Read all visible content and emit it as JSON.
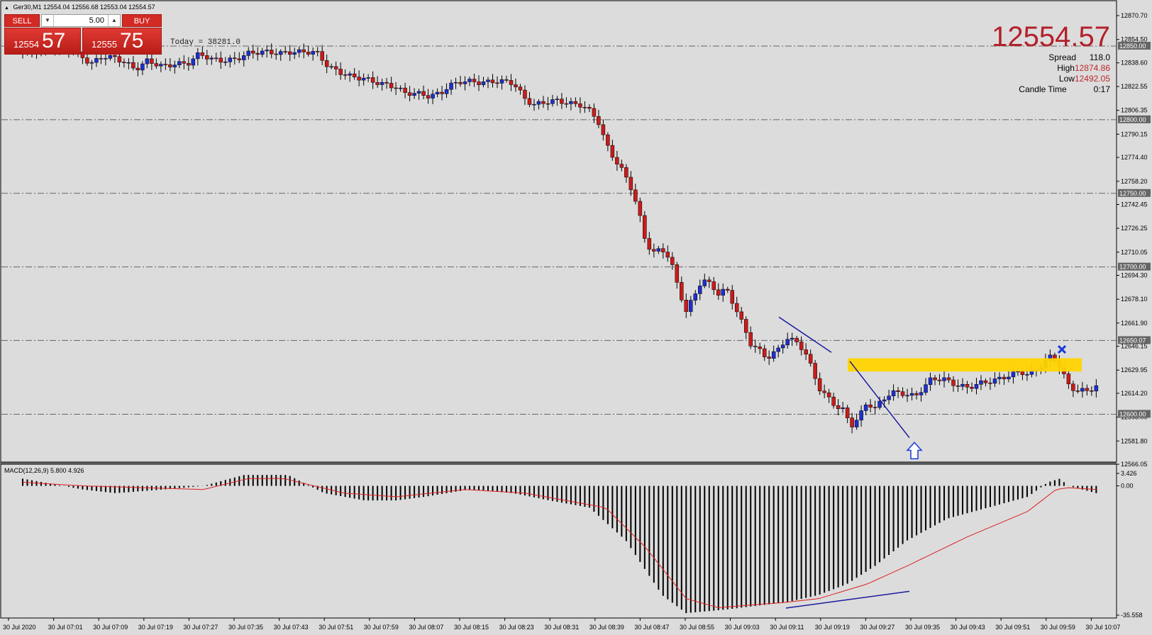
{
  "header": {
    "symbol_line": "Ger30,M1  12554.04 12556.68 12553.04 12554.57"
  },
  "trade_panel": {
    "sell_label": "SELL",
    "buy_label": "BUY",
    "lot_value": "5.00",
    "sell_small": "12554",
    "sell_big": "57",
    "buy_small": "12555",
    "buy_big": "75"
  },
  "info_panel": {
    "price": "12554.57",
    "spread_label": "Spread",
    "spread_value": "118.0",
    "high_label": "High",
    "high_value": "12874.86",
    "low_label": "Low",
    "low_value": "12492.05",
    "candle_time_label": "Candle Time",
    "candle_time_value": "0:17"
  },
  "today_label": "Today = 38281.0",
  "macd_label": "MACD(12,26,9) 5.800 4.926",
  "colors": {
    "background": "#dcdcdc",
    "bull": "#1f2fd0",
    "bear": "#cc1b1b",
    "highlight_zone": "#ffd400",
    "signal_line": "#e02020",
    "trendline": "#1a1aa0",
    "accent_price": "#b3212a"
  },
  "chart_data": {
    "type": "candlestick",
    "symbol": "Ger30",
    "timeframe": "M1",
    "y_axis_ticks": [
      "12870.70",
      "12854.50",
      "12838.60",
      "12822.55",
      "12806.35",
      "12790.15",
      "12774.40",
      "12758.20",
      "12742.45",
      "12726.25",
      "12710.05",
      "12694.30",
      "12678.10",
      "12661.90",
      "12646.15",
      "12629.95",
      "12614.20",
      "12598.00",
      "12581.80",
      "12566.05"
    ],
    "price_levels": [
      "12850.00",
      "12800.00",
      "12750.00",
      "12700.00",
      "12650.07",
      "12600.00"
    ],
    "ylim": [
      12566.05,
      12870.7
    ],
    "x_axis_ticks": [
      "30 Jul 2020",
      "30 Jul 07:01",
      "30 Jul 07:09",
      "30 Jul 07:19",
      "30 Jul 07:27",
      "30 Jul 07:35",
      "30 Jul 07:43",
      "30 Jul 07:51",
      "30 Jul 07:59",
      "30 Jul 08:07",
      "30 Jul 08:15",
      "30 Jul 08:23",
      "30 Jul 08:31",
      "30 Jul 08:39",
      "30 Jul 08:47",
      "30 Jul 08:55",
      "30 Jul 09:03",
      "30 Jul 09:11",
      "30 Jul 09:19",
      "30 Jul 09:27",
      "30 Jul 09:35",
      "30 Jul 09:43",
      "30 Jul 09:51",
      "30 Jul 09:59",
      "30 Jul 10:07"
    ],
    "close_path": [
      [
        0,
        12846
      ],
      [
        8,
        12847
      ],
      [
        16,
        12849
      ],
      [
        24,
        12848
      ],
      [
        30,
        12842
      ],
      [
        34,
        12838
      ],
      [
        40,
        12843
      ],
      [
        46,
        12842
      ],
      [
        52,
        12838
      ],
      [
        56,
        12834
      ],
      [
        62,
        12840
      ],
      [
        66,
        12838
      ],
      [
        70,
        12836
      ],
      [
        76,
        12838
      ],
      [
        82,
        12838
      ],
      [
        88,
        12845
      ],
      [
        94,
        12841
      ],
      [
        100,
        12840
      ],
      [
        106,
        12841
      ],
      [
        112,
        12845
      ],
      [
        118,
        12846
      ],
      [
        122,
        12846
      ],
      [
        128,
        12845
      ],
      [
        134,
        12846
      ],
      [
        140,
        12846
      ],
      [
        146,
        12846
      ],
      [
        152,
        12836
      ],
      [
        158,
        12832
      ],
      [
        164,
        12829
      ],
      [
        170,
        12828
      ],
      [
        174,
        12826
      ],
      [
        180,
        12824
      ],
      [
        186,
        12822
      ],
      [
        190,
        12818
      ],
      [
        196,
        12818
      ],
      [
        202,
        12816
      ],
      [
        208,
        12818
      ],
      [
        212,
        12823
      ],
      [
        218,
        12826
      ],
      [
        224,
        12826
      ],
      [
        228,
        12825
      ],
      [
        234,
        12826
      ],
      [
        240,
        12826
      ],
      [
        244,
        12825
      ],
      [
        250,
        12814
      ],
      [
        254,
        12810
      ],
      [
        260,
        12812
      ],
      [
        266,
        12813
      ],
      [
        272,
        12811
      ],
      [
        278,
        12810
      ],
      [
        282,
        12806
      ],
      [
        286,
        12800
      ],
      [
        290,
        12784
      ],
      [
        294,
        12774
      ],
      [
        298,
        12766
      ],
      [
        302,
        12756
      ],
      [
        306,
        12740
      ],
      [
        310,
        12716
      ],
      [
        314,
        12710
      ],
      [
        318,
        12712
      ],
      [
        322,
        12706
      ],
      [
        326,
        12686
      ],
      [
        330,
        12670
      ],
      [
        334,
        12680
      ],
      [
        338,
        12692
      ],
      [
        342,
        12688
      ],
      [
        346,
        12682
      ],
      [
        350,
        12685
      ],
      [
        356,
        12668
      ],
      [
        362,
        12648
      ],
      [
        366,
        12644
      ],
      [
        370,
        12638
      ],
      [
        376,
        12644
      ],
      [
        380,
        12652
      ],
      [
        386,
        12648
      ],
      [
        390,
        12640
      ],
      [
        396,
        12618
      ],
      [
        400,
        12612
      ],
      [
        404,
        12606
      ],
      [
        408,
        12603
      ],
      [
        412,
        12592
      ],
      [
        416,
        12598
      ],
      [
        420,
        12608
      ],
      [
        424,
        12604
      ],
      [
        428,
        12610
      ],
      [
        432,
        12615
      ],
      [
        438,
        12614
      ],
      [
        444,
        12612
      ],
      [
        448,
        12618
      ],
      [
        452,
        12624
      ],
      [
        458,
        12624
      ],
      [
        464,
        12620
      ],
      [
        470,
        12618
      ],
      [
        476,
        12621
      ],
      [
        480,
        12622
      ],
      [
        486,
        12624
      ],
      [
        490,
        12626
      ],
      [
        496,
        12629
      ],
      [
        500,
        12627
      ],
      [
        504,
        12630
      ],
      [
        508,
        12635
      ],
      [
        512,
        12640
      ],
      [
        516,
        12632
      ],
      [
        520,
        12620
      ],
      [
        524,
        12616
      ],
      [
        530,
        12616
      ],
      [
        534,
        12619
      ]
    ],
    "candle_count": 234,
    "annotations": {
      "trendlines": 3,
      "resistance_zone": [
        12629,
        12638
      ],
      "buy_arrow_near": 12575,
      "x_marker_near": 12644
    }
  },
  "macd_data": {
    "type": "histogram",
    "y_axis_ticks": [
      "3.426",
      "0.00",
      "-35.558"
    ],
    "ylim": [
      -35.558,
      3.426
    ],
    "hist_path": [
      [
        0,
        2
      ],
      [
        30,
        -1
      ],
      [
        46,
        -2
      ],
      [
        70,
        -1
      ],
      [
        90,
        0
      ],
      [
        110,
        3
      ],
      [
        132,
        3
      ],
      [
        150,
        -2
      ],
      [
        170,
        -4
      ],
      [
        186,
        -4
      ],
      [
        200,
        -3
      ],
      [
        222,
        -1
      ],
      [
        244,
        -2
      ],
      [
        262,
        -4
      ],
      [
        282,
        -6
      ],
      [
        300,
        -15
      ],
      [
        318,
        -30
      ],
      [
        330,
        -35
      ],
      [
        350,
        -34
      ],
      [
        380,
        -32
      ],
      [
        396,
        -30
      ],
      [
        410,
        -27
      ],
      [
        424,
        -22
      ],
      [
        440,
        -15
      ],
      [
        460,
        -9
      ],
      [
        480,
        -6
      ],
      [
        500,
        -3
      ],
      [
        510,
        1
      ],
      [
        516,
        2
      ],
      [
        520,
        0
      ],
      [
        534,
        -2
      ]
    ],
    "signal_path": [
      [
        0,
        1
      ],
      [
        30,
        0
      ],
      [
        90,
        -1
      ],
      [
        112,
        2
      ],
      [
        130,
        2
      ],
      [
        160,
        -2
      ],
      [
        186,
        -3
      ],
      [
        220,
        -1
      ],
      [
        250,
        -2
      ],
      [
        290,
        -6
      ],
      [
        310,
        -17
      ],
      [
        330,
        -31
      ],
      [
        346,
        -33.5
      ],
      [
        380,
        -32
      ],
      [
        396,
        -31
      ],
      [
        420,
        -27
      ],
      [
        440,
        -22
      ],
      [
        470,
        -14
      ],
      [
        500,
        -7
      ],
      [
        514,
        -1
      ],
      [
        520,
        -0.5
      ],
      [
        534,
        -1
      ]
    ]
  }
}
